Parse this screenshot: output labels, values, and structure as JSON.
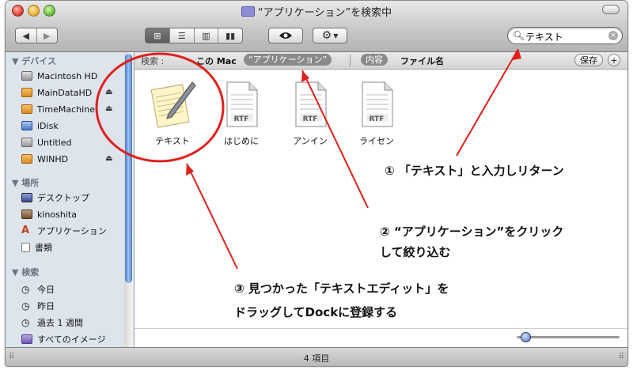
{
  "window": {
    "title": "“アプリケーション”を検索中",
    "status_count": "4 項目"
  },
  "toolbar": {
    "back_icon": "back-arrow-icon",
    "forward_icon": "forward-arrow-icon",
    "view_icons": [
      "icon-view-icon",
      "list-view-icon",
      "column-view-icon",
      "coverflow-view-icon"
    ],
    "quicklook_icon": "eye-icon",
    "action_icon": "gear-icon"
  },
  "search": {
    "value": "テキスト"
  },
  "sidebar": {
    "devices_header": "デバイス",
    "devices": [
      {
        "label": "Macintosh HD"
      },
      {
        "label": "MainDataHD"
      },
      {
        "label": "TimeMachine"
      },
      {
        "label": "iDisk"
      },
      {
        "label": "Untitled"
      },
      {
        "label": "WINHD"
      }
    ],
    "places_header": "場所",
    "places": [
      {
        "label": "デスクトップ"
      },
      {
        "label": "kinoshita"
      },
      {
        "label": "アプリケーション"
      },
      {
        "label": "書類"
      }
    ],
    "search_header": "検索",
    "searches": [
      {
        "label": "今日"
      },
      {
        "label": "昨日"
      },
      {
        "label": "過去 1 週間"
      },
      {
        "label": "すべてのイメージ"
      }
    ]
  },
  "scope": {
    "label": "検索 :",
    "this_mac": "この Mac",
    "applications": "“アプリケーション”",
    "contents": "内容",
    "filename": "ファイル名",
    "save": "保存",
    "add": "+"
  },
  "files": [
    {
      "label": "テキスト",
      "badge": ""
    },
    {
      "label": "はじめに",
      "badge": "RTF"
    },
    {
      "label": "アンイン",
      "badge": "RTF"
    },
    {
      "label": "ライセン",
      "badge": "RTF"
    }
  ],
  "annotations": {
    "step1": "① 「テキスト」と入力しリターン",
    "step2_line1": "② “アプリケーション”をクリック",
    "step2_line2": "して絞り込む",
    "step3_line1": "③ 見つかった「テキストエディット」を",
    "step3_line2": "ドラッグしてDockに登録する"
  },
  "colors": {
    "annotation_red": "#e0201c",
    "sidebar_bg": "#dde4ec",
    "scroll_blue": "#4a78c8"
  }
}
